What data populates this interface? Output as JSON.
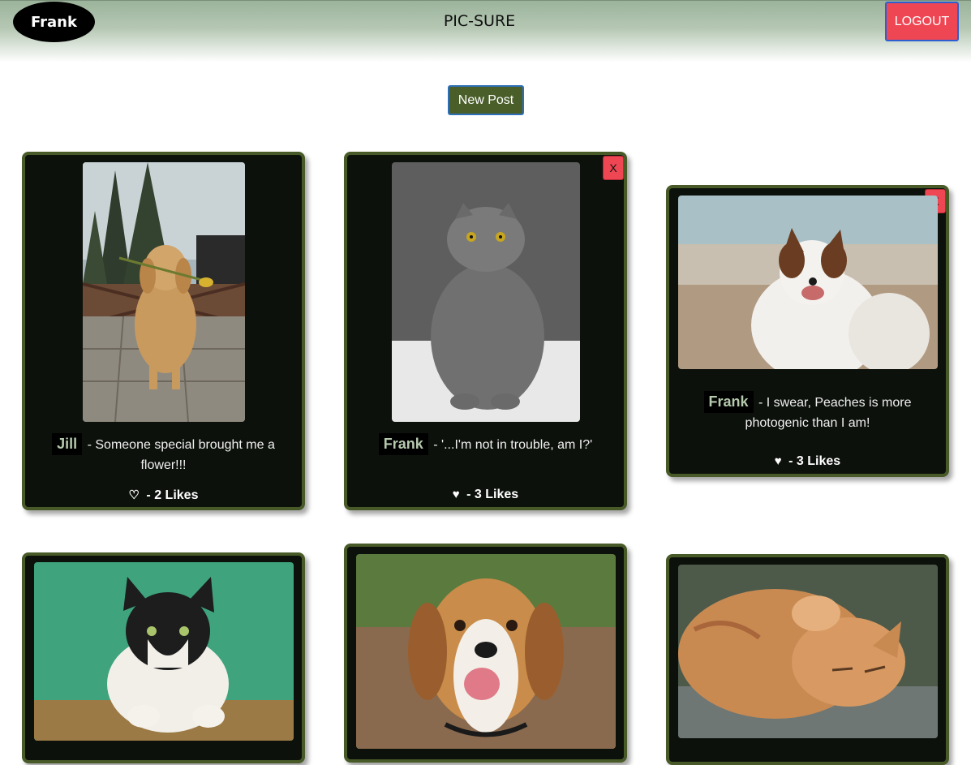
{
  "header": {
    "user": "Frank",
    "title": "PIC-SURE",
    "logout_label": "LOGOUT"
  },
  "actions": {
    "new_post_label": "New Post"
  },
  "posts": [
    {
      "author": "Jill",
      "caption": " - Someone special brought me a flower!!!",
      "likes": " - 2 Likes",
      "liked": false,
      "delete_label": ""
    },
    {
      "author": "Frank",
      "caption": " - '...I'm not in trouble, am I?'",
      "likes": " - 3 Likes",
      "liked": true,
      "delete_label": "X"
    },
    {
      "author": "Frank",
      "caption": " - I swear, Peaches is more photogenic than I am!",
      "likes": " - 3 Likes",
      "liked": true,
      "delete_label": "X"
    }
  ],
  "icons": {
    "liked": "heart-filled-icon",
    "unliked": "heart-outline-icon"
  },
  "colors": {
    "card_bg": "#0d110c",
    "card_border": "#485a27",
    "danger": "#ef4653",
    "primary": "#4a5e2a"
  }
}
